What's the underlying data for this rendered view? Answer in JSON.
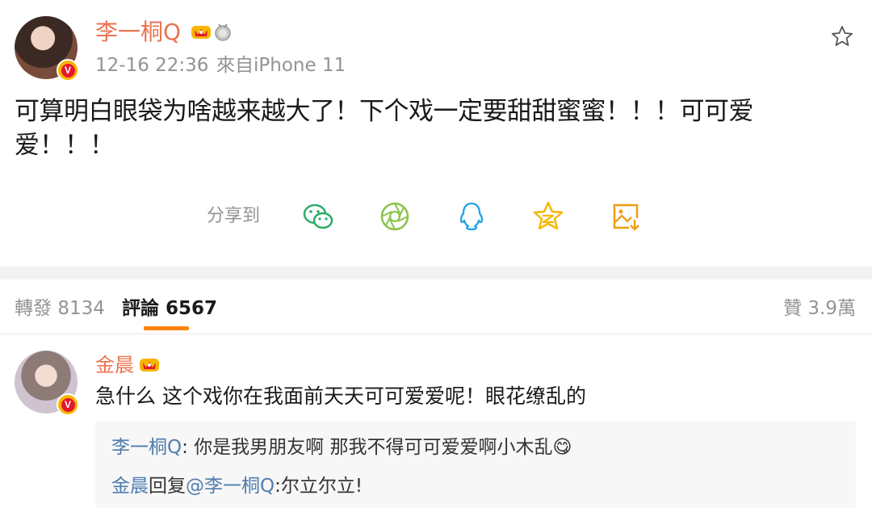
{
  "post": {
    "author": "李一桐Q",
    "timestamp": "12-16 22:36",
    "source": "來自iPhone 11",
    "text_line1": "可算明白眼袋为啥越来越大了！下个戏一定要甜甜蜜蜜！！！可可爱",
    "text_line2": "爱！！！",
    "verified_badge": "V"
  },
  "share": {
    "label": "分享到",
    "icons": [
      "wechat-icon",
      "moments-icon",
      "qq-icon",
      "qzone-icon",
      "save-image-icon"
    ]
  },
  "tabs": {
    "repost_label": "轉發",
    "repost_count": "8134",
    "comment_label": "評論",
    "comment_count": "6567",
    "like_label": "贊",
    "like_count": "3.9萬"
  },
  "comment": {
    "author": "金晨",
    "text": "急什么 这个戏你在我面前天天可可爱爱呢！眼花缭乱的",
    "verified_badge": "V",
    "replies": [
      {
        "author": "李一桐Q",
        "sep": ": ",
        "text": "你是我男朋友啊 那我不得可可爱爱啊小木乱",
        "emoji": "😋"
      },
      {
        "author": "金晨",
        "mid": "回复",
        "mention": "@李一桐Q",
        "sep": ":",
        "text": "尔立尔立!"
      }
    ]
  },
  "colors": {
    "accent_orange": "#eb7350",
    "link_blue": "#507daf",
    "share_green": "#2aae67",
    "share_blue": "#1fa3e8",
    "share_yellow": "#f5b800",
    "share_orange": "#f09c13"
  }
}
